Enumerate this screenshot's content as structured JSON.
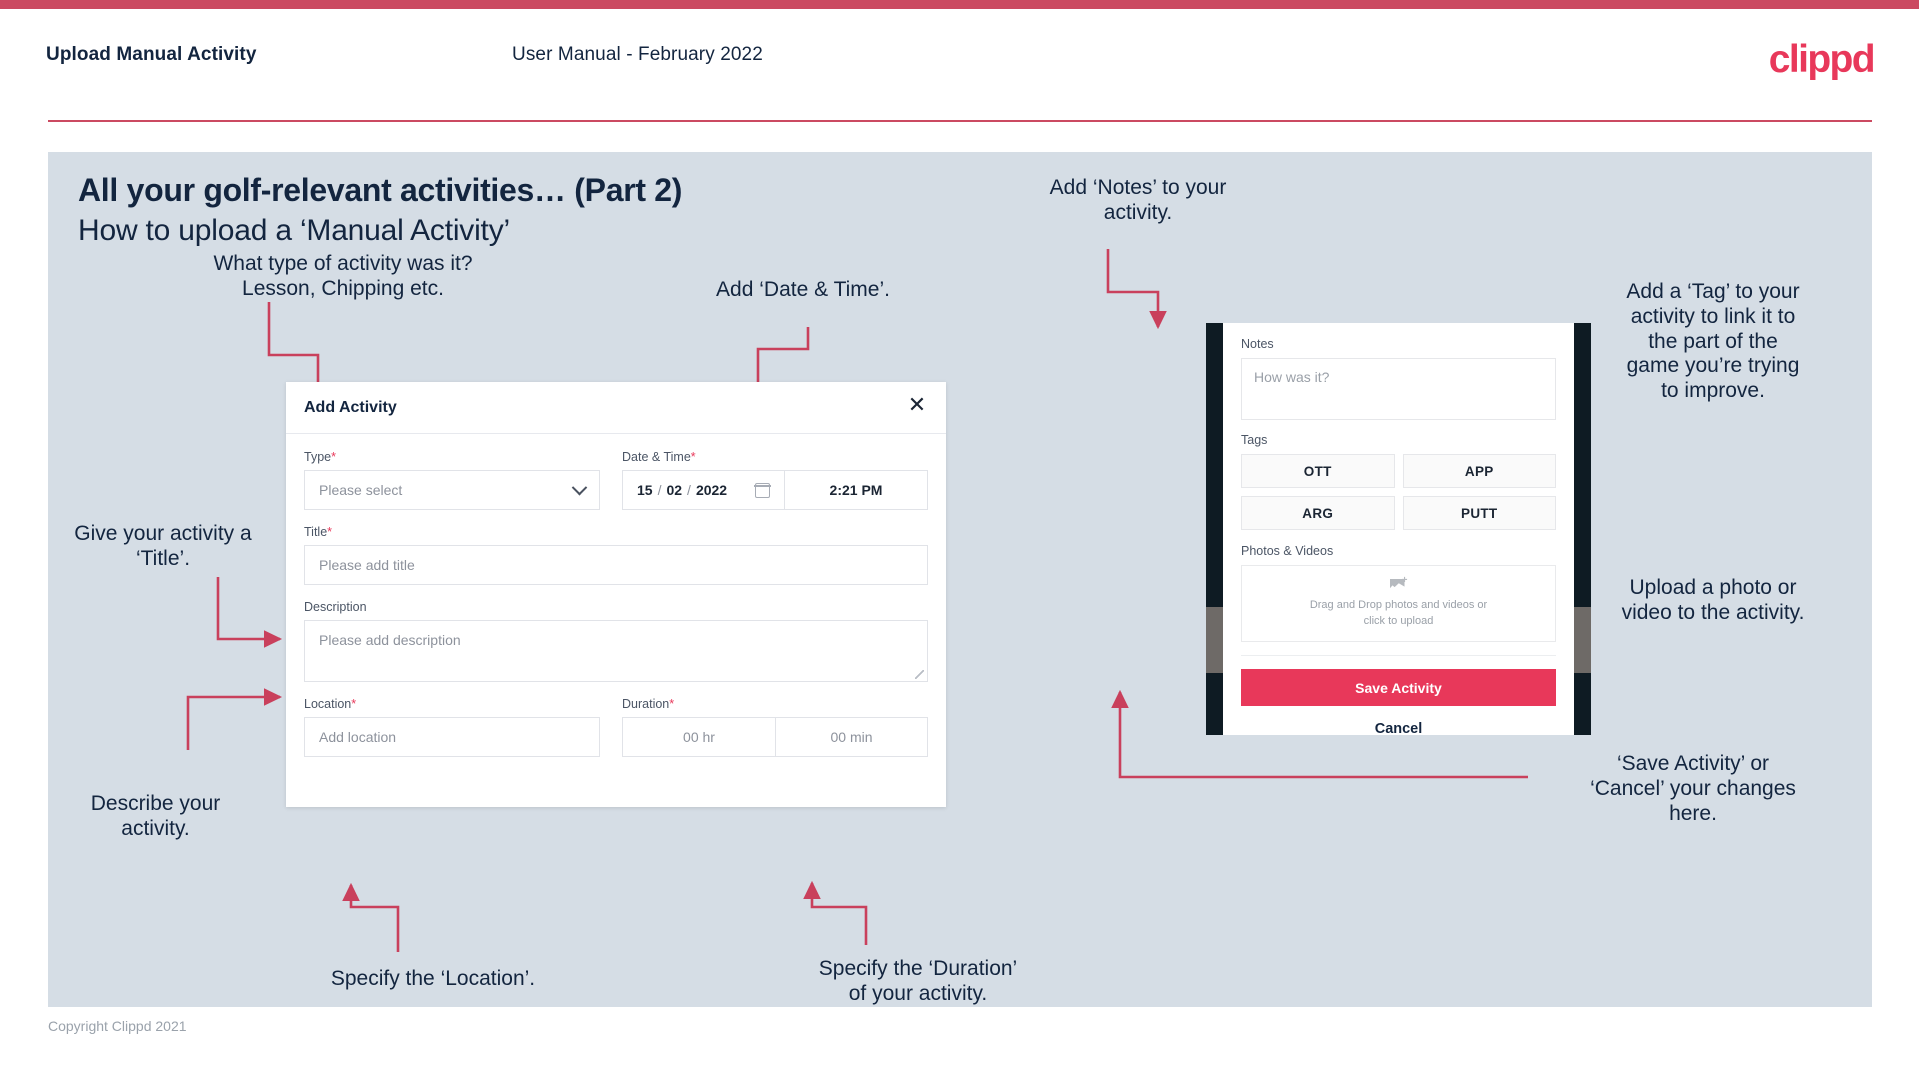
{
  "header": {
    "title": "Upload Manual Activity",
    "subtitle": "User Manual - February 2022",
    "brand": "clippd"
  },
  "slide": {
    "title": "All your golf-relevant activities… (Part 2)",
    "subtitle": "How to upload a ‘Manual Activity’"
  },
  "annotations": {
    "type": "What type of activity was it?\nLesson, Chipping etc.",
    "date_time": "Add ‘Date & Time’.",
    "title_field": "Give your activity a\n‘Title’.",
    "description": "Describe your\nactivity.",
    "location": "Specify the ‘Location’.",
    "duration": "Specify the ‘Duration’\nof your activity.",
    "notes": "Add ‘Notes’ to your\nactivity.",
    "tags": "Add a ‘Tag’ to your\nactivity to link it to\nthe part of the\ngame you’re trying\nto improve.",
    "photos": "Upload a photo or\nvideo to the activity.",
    "save_cancel": "‘Save Activity’ or\n‘Cancel’ your changes\nhere."
  },
  "dialog": {
    "title": "Add Activity",
    "close_icon": "close-icon",
    "fields": {
      "type": {
        "label": "Type",
        "required": "*",
        "placeholder": "Please select"
      },
      "datetime": {
        "label": "Date & Time",
        "required": "*",
        "day": "15",
        "month": "02",
        "year": "2022",
        "sep": "/",
        "time": "2:21 PM"
      },
      "title": {
        "label": "Title",
        "required": "*",
        "placeholder": "Please add title"
      },
      "description": {
        "label": "Description",
        "placeholder": "Please add description"
      },
      "location": {
        "label": "Location",
        "required": "*",
        "placeholder": "Add location"
      },
      "duration": {
        "label": "Duration",
        "required": "*",
        "hours": "00 hr",
        "minutes": "00 min"
      }
    }
  },
  "mobile": {
    "notes": {
      "label": "Notes",
      "placeholder": "How was it?"
    },
    "tags": {
      "label": "Tags",
      "items": [
        "OTT",
        "APP",
        "ARG",
        "PUTT"
      ]
    },
    "photos": {
      "label": "Photos & Videos",
      "dropzone_line1": "Drag and Drop photos and videos or",
      "dropzone_line2": "click to upload"
    },
    "save_label": "Save Activity",
    "cancel_label": "Cancel"
  },
  "footer": "Copyright Clippd 2021",
  "colors": {
    "accent": "#e8385a",
    "top_bar": "#cb4a61",
    "slide_bg": "#d5dde5",
    "ink": "#13253f",
    "arrow": "#c9405c"
  }
}
